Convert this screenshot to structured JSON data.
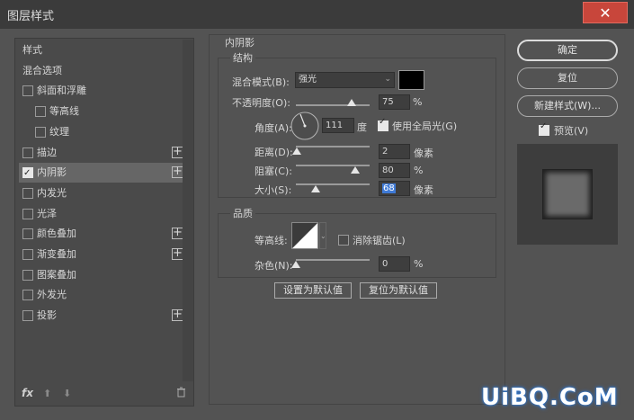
{
  "window": {
    "title": "图层样式",
    "close_label": "✕"
  },
  "left_panel": {
    "items": [
      {
        "label": "样式",
        "has_checkbox": false,
        "checked": false,
        "has_plus": false
      },
      {
        "label": "混合选项",
        "has_checkbox": false,
        "checked": false,
        "has_plus": false
      },
      {
        "label": "斜面和浮雕",
        "has_checkbox": true,
        "checked": false,
        "has_plus": false
      },
      {
        "label": "等高线",
        "has_checkbox": true,
        "checked": false,
        "has_plus": false
      },
      {
        "label": "纹理",
        "has_checkbox": true,
        "checked": false,
        "has_plus": false
      },
      {
        "label": "描边",
        "has_checkbox": true,
        "checked": false,
        "has_plus": true
      },
      {
        "label": "内阴影",
        "has_checkbox": true,
        "checked": true,
        "has_plus": true
      },
      {
        "label": "内发光",
        "has_checkbox": true,
        "checked": false,
        "has_plus": false
      },
      {
        "label": "光泽",
        "has_checkbox": true,
        "checked": false,
        "has_plus": false
      },
      {
        "label": "颜色叠加",
        "has_checkbox": true,
        "checked": false,
        "has_plus": true
      },
      {
        "label": "渐变叠加",
        "has_checkbox": true,
        "checked": false,
        "has_plus": true
      },
      {
        "label": "图案叠加",
        "has_checkbox": true,
        "checked": false,
        "has_plus": false
      },
      {
        "label": "外发光",
        "has_checkbox": true,
        "checked": false,
        "has_plus": false
      },
      {
        "label": "投影",
        "has_checkbox": true,
        "checked": false,
        "has_plus": true
      }
    ],
    "footer": {
      "fx": "fx",
      "up_icon": "arrow-up-icon",
      "down_icon": "arrow-down-icon",
      "trash_icon": "trash-icon"
    }
  },
  "inner_shadow": {
    "section_title": "内阴影",
    "structure": {
      "title": "结构",
      "blend_mode_label": "混合模式(B):",
      "blend_mode_value": "强光",
      "shadow_color": "#000000",
      "opacity_label": "不透明度(O):",
      "opacity_value": "75",
      "opacity_percent": 75,
      "percent_unit": "%",
      "angle_label": "角度(A):",
      "angle_value": "111",
      "angle_unit": "度",
      "global_light_label": "使用全局光(G)",
      "global_light_checked": true,
      "distance_label": "距离(D):",
      "distance_value": "2",
      "distance_fraction": 0.01,
      "pixel_unit": "像素",
      "choke_label": "阻塞(C):",
      "choke_value": "80",
      "choke_percent": 80,
      "size_label": "大小(S):",
      "size_value": "68",
      "size_fraction": 0.27
    },
    "quality": {
      "title": "品质",
      "contour_label": "等高线:",
      "anti_alias_label": "消除锯齿(L)",
      "anti_alias_checked": false,
      "noise_label": "杂色(N):",
      "noise_value": "0",
      "noise_percent": 0
    },
    "buttons": {
      "make_default": "设置为默认值",
      "reset_default": "复位为默认值"
    }
  },
  "right_panel": {
    "ok": "确定",
    "reset": "复位",
    "new_style": "新建样式(W)...",
    "preview_label": "预览(V)",
    "preview_checked": true
  },
  "watermark": "UiBQ.CoM"
}
